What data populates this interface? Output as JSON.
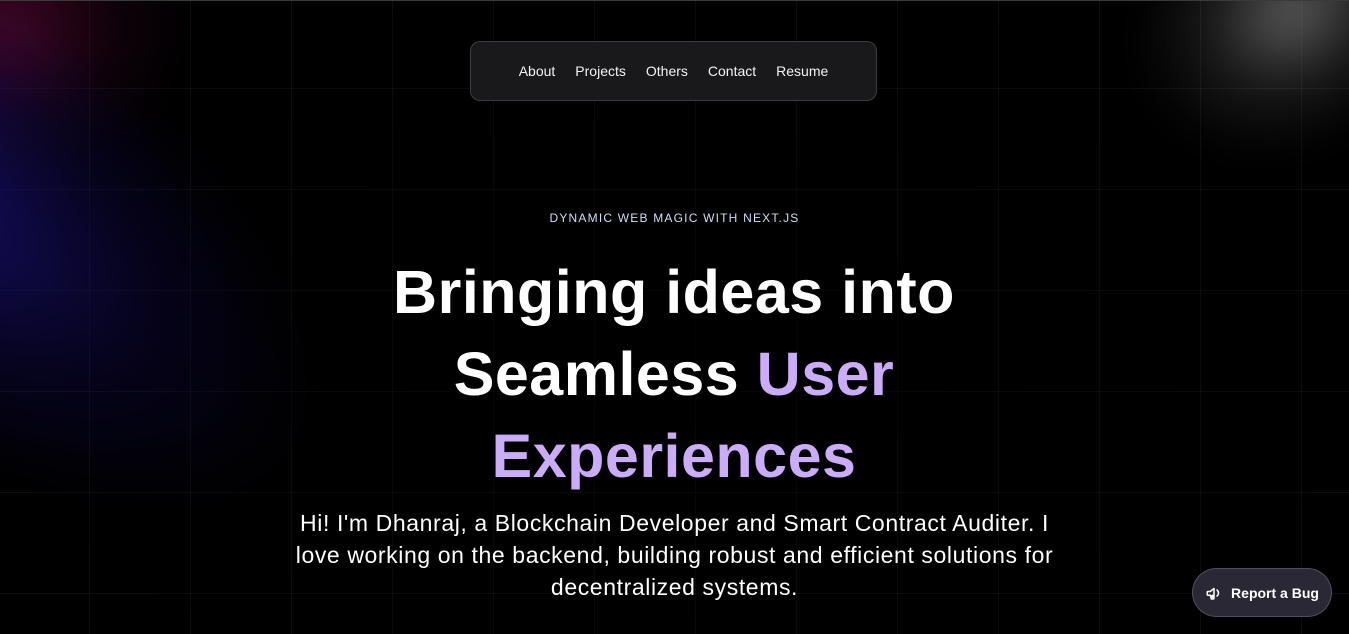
{
  "nav": {
    "items": [
      {
        "label": "About"
      },
      {
        "label": "Projects"
      },
      {
        "label": "Others"
      },
      {
        "label": "Contact"
      },
      {
        "label": "Resume"
      }
    ]
  },
  "hero": {
    "eyebrow": "DYNAMIC WEB MAGIC WITH NEXT.JS",
    "headline_line1": "Bringing ideas into",
    "headline_line2_plain": "Seamless",
    "headline_line2_accent": "User",
    "headline_line3_accent": "Experiences",
    "intro": "Hi! I'm Dhanraj, a Blockchain Developer and Smart Contract Auditer. I love working on the backend, building robust and efficient solutions for decentralized systems."
  },
  "report_bug": {
    "label": "Report a Bug",
    "icon": "megaphone-icon"
  },
  "colors": {
    "background": "#000000",
    "accent": "#cbacf9",
    "nav_background": "#1a1a1c",
    "button_background": "#2a2834"
  }
}
